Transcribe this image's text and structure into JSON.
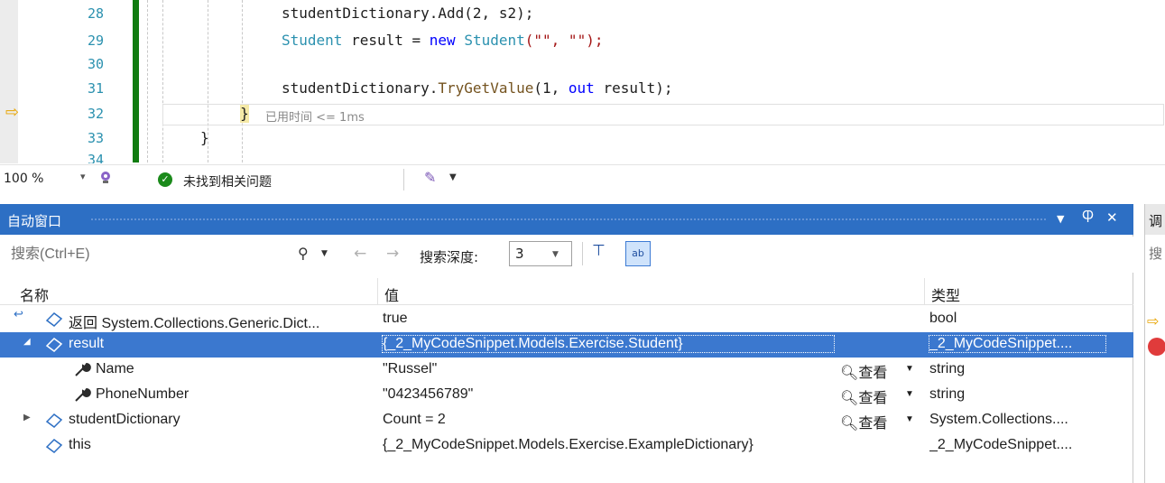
{
  "editor": {
    "lines": [
      {
        "num": "28",
        "code": "studentDictionary.Add(2, s2);"
      },
      {
        "num": "29"
      },
      {
        "num": "30"
      },
      {
        "num": "31"
      },
      {
        "num": "32"
      },
      {
        "num": "33"
      },
      {
        "num": "34"
      }
    ],
    "line29": {
      "type1": "Student",
      "var": "result",
      "eq": " = ",
      "kw": "new",
      "type2": "Student",
      "args": "(\"\", \"\");"
    },
    "line31": {
      "obj": "studentDictionary.",
      "method": "TryGetValue",
      "open": "(1, ",
      "kw": "out",
      "var": "result",
      "close": ");"
    },
    "line32": {
      "brace": "}",
      "perf_tip": "已用时间 <= 1ms"
    },
    "line33": {
      "brace": "}"
    }
  },
  "status_strip": {
    "zoom": "100 %",
    "issues": "未找到相关问题"
  },
  "autos": {
    "title": "自动窗口",
    "search_placeholder": "搜索(Ctrl+E)",
    "depth_label": "搜索深度:",
    "depth_value": "3",
    "columns": {
      "name": "名称",
      "value": "值",
      "type": "类型"
    },
    "rows": [
      {
        "name": "返回 System.Collections.Generic.Dict...",
        "value": "true",
        "type": "bool"
      },
      {
        "name": "result",
        "value": "{_2_MyCodeSnippet.Models.Exercise.Student}",
        "type": "_2_MyCodeSnippet...."
      },
      {
        "name": "Name",
        "value": "\"Russel\"",
        "type": "string",
        "view": "查看"
      },
      {
        "name": "PhoneNumber",
        "value": "\"0423456789\"",
        "type": "string",
        "view": "查看"
      },
      {
        "name": "studentDictionary",
        "value": "Count = 2",
        "type": "System.Collections....",
        "view": "查看"
      },
      {
        "name": "this",
        "value": "{_2_MyCodeSnippet.Models.Exercise.ExampleDictionary}",
        "type": "_2_MyCodeSnippet...."
      }
    ]
  },
  "right_pane": {
    "title": "调",
    "search": "搜"
  },
  "colors": {
    "accent": "#2d6fc4",
    "selection": "#3b78cf",
    "change_bar": "#107c10",
    "breakpoint": "#e03b3b",
    "exec_arrow": "#e8a400"
  },
  "icons": {
    "exec_arrow": "arrow-right-icon",
    "search": "search-icon",
    "pin": "pin-icon",
    "hex": "hex-display-icon",
    "property": "wrench-icon",
    "object": "object-icon",
    "return": "return-value-icon"
  }
}
